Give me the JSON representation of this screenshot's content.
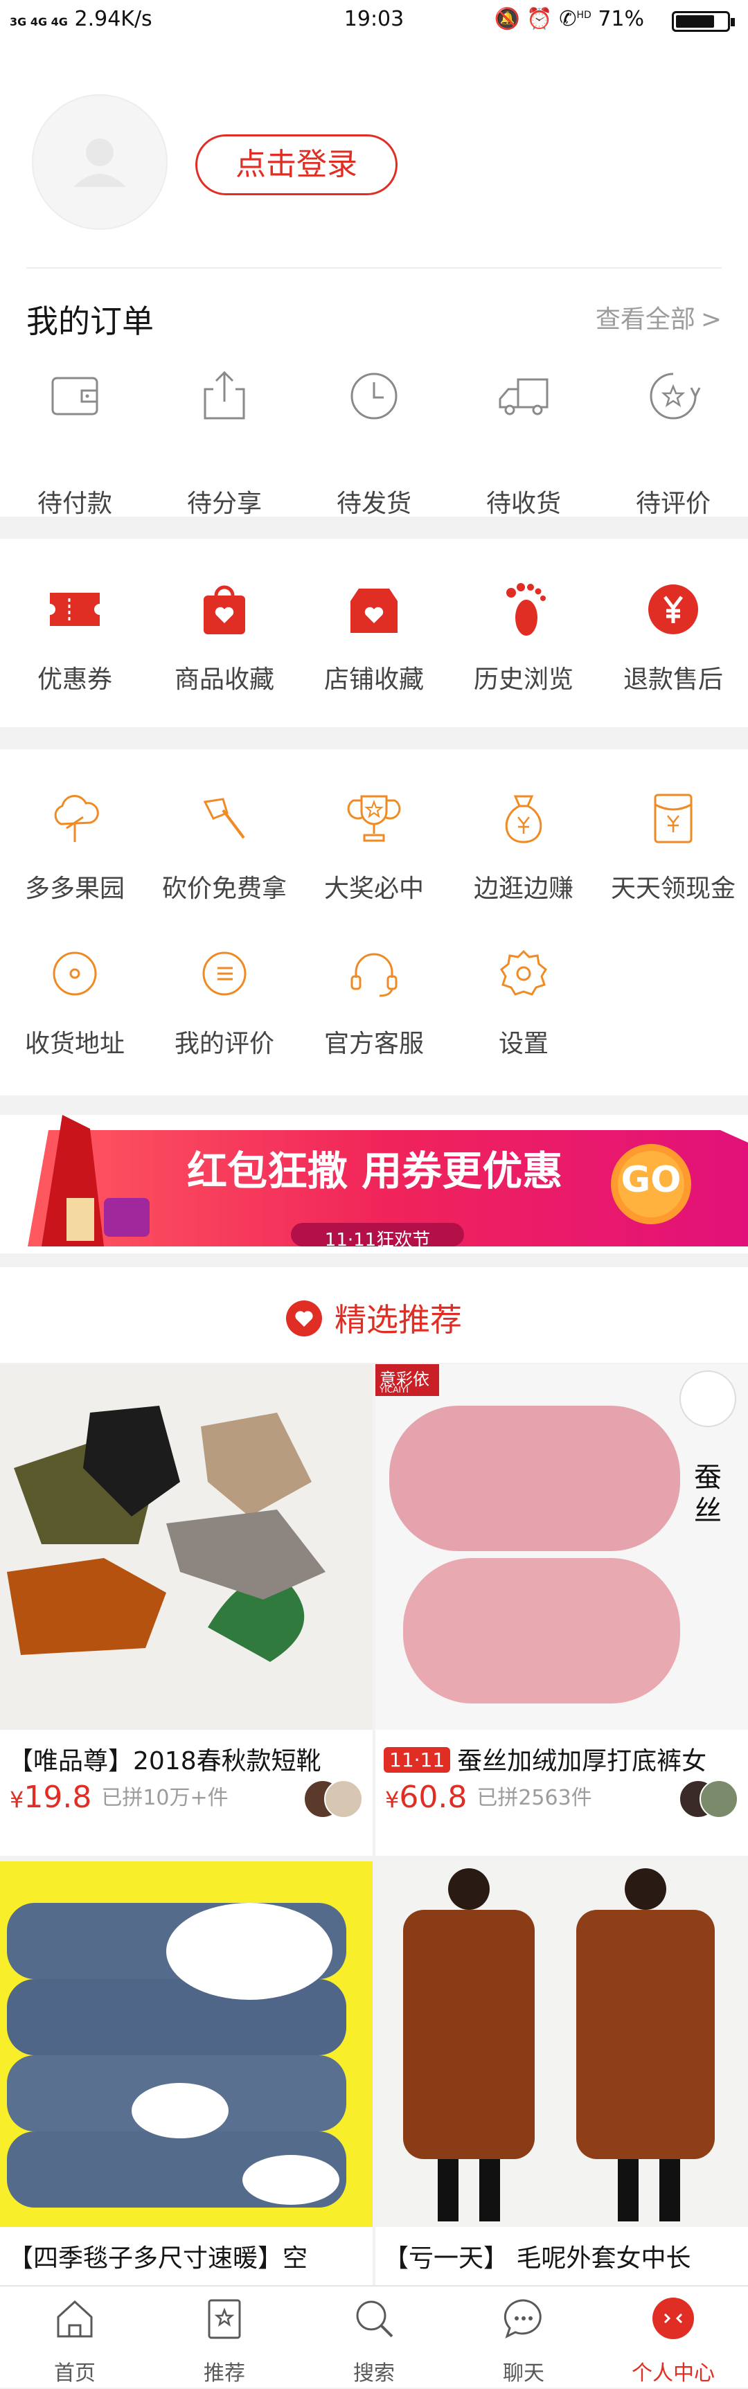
{
  "status_bar": {
    "network": "3G 4G 4G",
    "speed": "2.94K/s",
    "time": "19:03",
    "indicators": "HD",
    "battery": "71%"
  },
  "header": {
    "login_label": "点击登录"
  },
  "orders": {
    "title": "我的订单",
    "view_all": "查看全部",
    "items": [
      {
        "label": "待付款",
        "icon": "wallet-icon"
      },
      {
        "label": "待分享",
        "icon": "share-icon"
      },
      {
        "label": "待发货",
        "icon": "clock-icon"
      },
      {
        "label": "待收货",
        "icon": "truck-icon"
      },
      {
        "label": "待评价",
        "icon": "review-icon"
      }
    ]
  },
  "favorites": {
    "items": [
      {
        "label": "优惠券",
        "icon": "coupon-icon"
      },
      {
        "label": "商品收藏",
        "icon": "bag-heart-icon"
      },
      {
        "label": "店铺收藏",
        "icon": "store-heart-icon"
      },
      {
        "label": "历史浏览",
        "icon": "footprint-icon"
      },
      {
        "label": "退款售后",
        "icon": "yen-icon"
      }
    ]
  },
  "services": {
    "items": [
      {
        "label": "多多果园",
        "icon": "tree-icon"
      },
      {
        "label": "砍价免费拿",
        "icon": "axe-icon"
      },
      {
        "label": "大奖必中",
        "icon": "trophy-icon"
      },
      {
        "label": "边逛边赚",
        "icon": "money-bag-icon"
      },
      {
        "label": "天天领现金",
        "icon": "red-envelope-icon"
      },
      {
        "label": "收货地址",
        "icon": "location-icon"
      },
      {
        "label": "我的评价",
        "icon": "comment-icon"
      },
      {
        "label": "官方客服",
        "icon": "headset-icon"
      },
      {
        "label": "设置",
        "icon": "gear-icon"
      }
    ]
  },
  "banner": {
    "headline": "红包狂撒 用券更优惠",
    "sub": "11·11狂欢节",
    "go": "GO"
  },
  "recommend": {
    "title": "精选推荐",
    "products": [
      {
        "name": "【唯品尊】2018春秋款短靴",
        "price": "19.8",
        "sold": "已拼10万+件",
        "badge": ""
      },
      {
        "name": "蚕丝加绒加厚打底裤女",
        "price": "60.8",
        "sold": "已拼2563件",
        "badge": "11·11",
        "brand": "意彩依",
        "brand_sub": "YICAIYI",
        "tag": "蚕丝"
      },
      {
        "name": "【四季毯子多尺寸速暖】空",
        "price": "",
        "sold": "",
        "badge": ""
      },
      {
        "name": "【亏一天】 毛呢外套女中长",
        "price": "",
        "sold": "",
        "badge": ""
      }
    ]
  },
  "tabbar": {
    "tabs": [
      {
        "label": "首页",
        "icon": "home-icon"
      },
      {
        "label": "推荐",
        "icon": "recommend-icon"
      },
      {
        "label": "搜索",
        "icon": "search-icon"
      },
      {
        "label": "聊天",
        "icon": "chat-icon"
      },
      {
        "label": "个人中心",
        "icon": "profile-icon"
      }
    ]
  },
  "colors": {
    "accent": "#e02e24",
    "orange": "#f08a24",
    "text": "#151516",
    "muted": "#9c9c9c"
  }
}
